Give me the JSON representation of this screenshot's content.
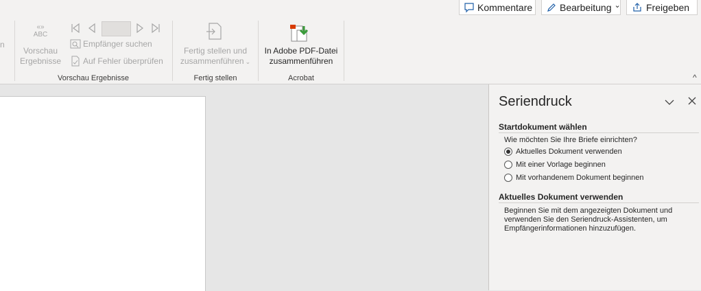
{
  "header": {
    "comments_label": "Kommentare",
    "editing_label": "Bearbeitung",
    "editing_chevron": "⌄",
    "share_label": "Freigeben"
  },
  "ribbon": {
    "left_edge_label": "n",
    "preview": {
      "icon_text_top": "«»",
      "icon_text_bottom": "ABC",
      "button_line1": "Vorschau",
      "button_line2": "Ergebnisse",
      "find_recipient": "Empfänger suchen",
      "check_errors": "Auf Fehler überprüfen",
      "group_label": "Vorschau Ergebnisse"
    },
    "finish": {
      "button_line1": "Fertig stellen und",
      "button_line2": "zusammenführen",
      "chevron": "⌄",
      "group_label": "Fertig stellen"
    },
    "acrobat": {
      "button_line1": "In Adobe PDF-Datei",
      "button_line2": "zusammenführen",
      "group_label": "Acrobat"
    },
    "collapse_icon": "^"
  },
  "pane": {
    "title": "Seriendruck",
    "section1_heading": "Startdokument wählen",
    "question": "Wie möchten Sie Ihre Briefe einrichten?",
    "options": [
      "Aktuelles Dokument verwenden",
      "Mit einer Vorlage beginnen",
      "Mit vorhandenem Dokument beginnen"
    ],
    "selected_option": 0,
    "section2_heading": "Aktuelles Dokument verwenden",
    "description": "Beginnen Sie mit dem angezeigten Dokument und verwenden Sie den Seriendruck-Assistenten, um Empfängerinformationen hinzuzufügen."
  }
}
